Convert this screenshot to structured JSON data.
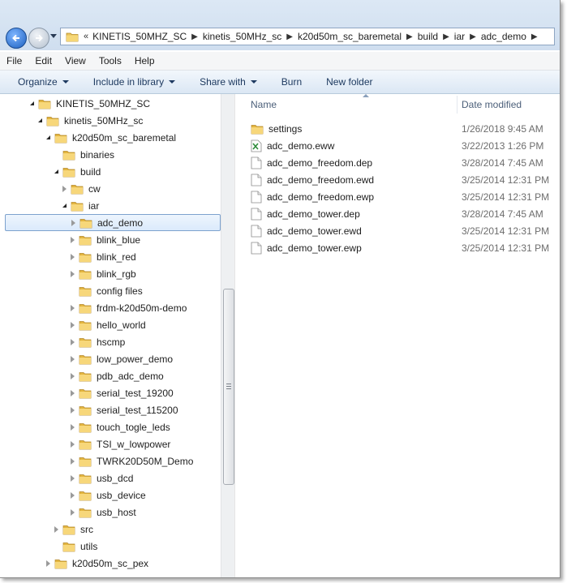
{
  "breadcrumb": {
    "lead": "«",
    "items": [
      "KINETIS_50MHZ_SC",
      "kinetis_50MHz_sc",
      "k20d50m_sc_baremetal",
      "build",
      "iar",
      "adc_demo"
    ]
  },
  "menu": [
    "File",
    "Edit",
    "View",
    "Tools",
    "Help"
  ],
  "toolbar": {
    "organize": "Organize",
    "include": "Include in library",
    "share": "Share with",
    "burn": "Burn",
    "new_folder": "New folder"
  },
  "tree": [
    {
      "label": "KINETIS_50MHZ_SC",
      "level": 0,
      "state": "open"
    },
    {
      "label": "kinetis_50MHz_sc",
      "level": 1,
      "state": "open"
    },
    {
      "label": "k20d50m_sc_baremetal",
      "level": 2,
      "state": "open"
    },
    {
      "label": "binaries",
      "level": 3,
      "state": "none"
    },
    {
      "label": "build",
      "level": 3,
      "state": "open"
    },
    {
      "label": "cw",
      "level": 4,
      "state": "closed"
    },
    {
      "label": "iar",
      "level": 4,
      "state": "open"
    },
    {
      "label": "adc_demo",
      "level": 5,
      "state": "closed",
      "selected": true
    },
    {
      "label": "blink_blue",
      "level": 5,
      "state": "closed"
    },
    {
      "label": "blink_red",
      "level": 5,
      "state": "closed"
    },
    {
      "label": "blink_rgb",
      "level": 5,
      "state": "closed"
    },
    {
      "label": "config files",
      "level": 5,
      "state": "none"
    },
    {
      "label": "frdm-k20d50m-demo",
      "level": 5,
      "state": "closed"
    },
    {
      "label": "hello_world",
      "level": 5,
      "state": "closed"
    },
    {
      "label": "hscmp",
      "level": 5,
      "state": "closed"
    },
    {
      "label": "low_power_demo",
      "level": 5,
      "state": "closed"
    },
    {
      "label": "pdb_adc_demo",
      "level": 5,
      "state": "closed"
    },
    {
      "label": "serial_test_19200",
      "level": 5,
      "state": "closed"
    },
    {
      "label": "serial_test_115200",
      "level": 5,
      "state": "closed"
    },
    {
      "label": "touch_togle_leds",
      "level": 5,
      "state": "closed"
    },
    {
      "label": "TSI_w_lowpower",
      "level": 5,
      "state": "closed"
    },
    {
      "label": "TWRK20D50M_Demo",
      "level": 5,
      "state": "closed"
    },
    {
      "label": "usb_dcd",
      "level": 5,
      "state": "closed"
    },
    {
      "label": "usb_device",
      "level": 5,
      "state": "closed"
    },
    {
      "label": "usb_host",
      "level": 5,
      "state": "closed"
    },
    {
      "label": "src",
      "level": 3,
      "state": "closed"
    },
    {
      "label": "utils",
      "level": 3,
      "state": "none"
    },
    {
      "label": "k20d50m_sc_pex",
      "level": 2,
      "state": "closed"
    }
  ],
  "list": {
    "col_name": "Name",
    "col_date": "Date modified",
    "files": [
      {
        "name": "settings",
        "date": "1/26/2018 9:45 AM",
        "icon": "folder-icon"
      },
      {
        "name": "adc_demo.eww",
        "date": "3/22/2013 1:26 PM",
        "icon": "workspace-file-icon"
      },
      {
        "name": "adc_demo_freedom.dep",
        "date": "3/28/2014 7:45 AM",
        "icon": "file-icon"
      },
      {
        "name": "adc_demo_freedom.ewd",
        "date": "3/25/2014 12:31 PM",
        "icon": "file-icon"
      },
      {
        "name": "adc_demo_freedom.ewp",
        "date": "3/25/2014 12:31 PM",
        "icon": "file-icon"
      },
      {
        "name": "adc_demo_tower.dep",
        "date": "3/28/2014 7:45 AM",
        "icon": "file-icon"
      },
      {
        "name": "adc_demo_tower.ewd",
        "date": "3/25/2014 12:31 PM",
        "icon": "file-icon"
      },
      {
        "name": "adc_demo_tower.ewp",
        "date": "3/25/2014 12:31 PM",
        "icon": "file-icon"
      }
    ]
  }
}
